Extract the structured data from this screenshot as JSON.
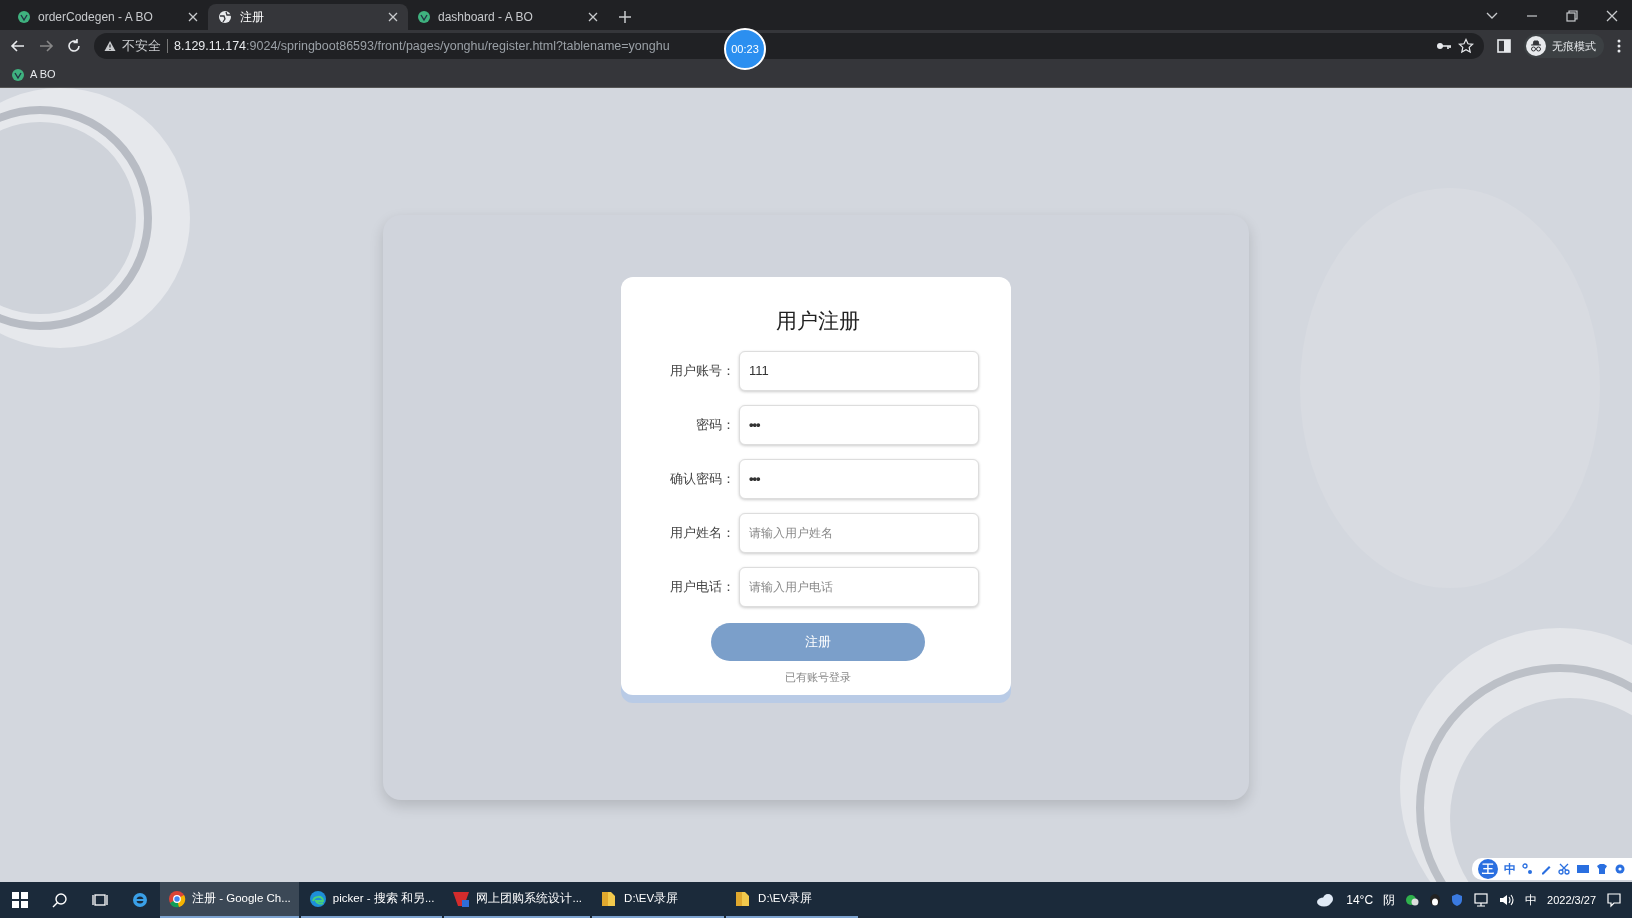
{
  "browser": {
    "tabs": [
      {
        "title": "orderCodegen - A BO",
        "kind": "vue",
        "selected": false
      },
      {
        "title": "注册",
        "kind": "globe",
        "selected": true
      },
      {
        "title": "dashboard - A BO",
        "kind": "vue",
        "selected": false
      }
    ],
    "address": {
      "security": "不安全",
      "host": "8.129.11.174",
      "path": ":9024/springboot86593/front/pages/yonghu/register.html?tablename=yonghu"
    },
    "recording_timer": "00:23",
    "profile": "无痕模式",
    "bookmarks": [
      {
        "label": "A BO",
        "kind": "vue"
      }
    ]
  },
  "form": {
    "title": "用户注册",
    "fields": [
      {
        "label": "用户账号：",
        "kind": "text",
        "value": "111"
      },
      {
        "label": "密码：",
        "kind": "password",
        "value": "•••"
      },
      {
        "label": "确认密码：",
        "kind": "password",
        "value": "•••"
      },
      {
        "label": "用户姓名：",
        "kind": "text",
        "placeholder": "请输入用户姓名"
      },
      {
        "label": "用户电话：",
        "kind": "text",
        "placeholder": "请输入用户电话"
      }
    ],
    "submit": "注册",
    "login_link": "已有账号登录"
  },
  "ime_toolbar": {
    "logo": "王",
    "mode": "中"
  },
  "taskbar": {
    "apps": [
      {
        "label": "注册 - Google Ch...",
        "kind": "chrome",
        "selected": true
      },
      {
        "label": "picker - 搜索 和另...",
        "kind": "edge",
        "selected": false
      },
      {
        "label": "网上团购系统设计...",
        "kind": "wps",
        "selected": false
      },
      {
        "label": "D:\\EV录屏",
        "kind": "folder",
        "selected": false
      },
      {
        "label": "D:\\EV录屏",
        "kind": "folder",
        "selected": false
      }
    ],
    "weather": "14°C",
    "weather_text": "阴",
    "input_mode": "中",
    "date": "2022/3/27"
  }
}
